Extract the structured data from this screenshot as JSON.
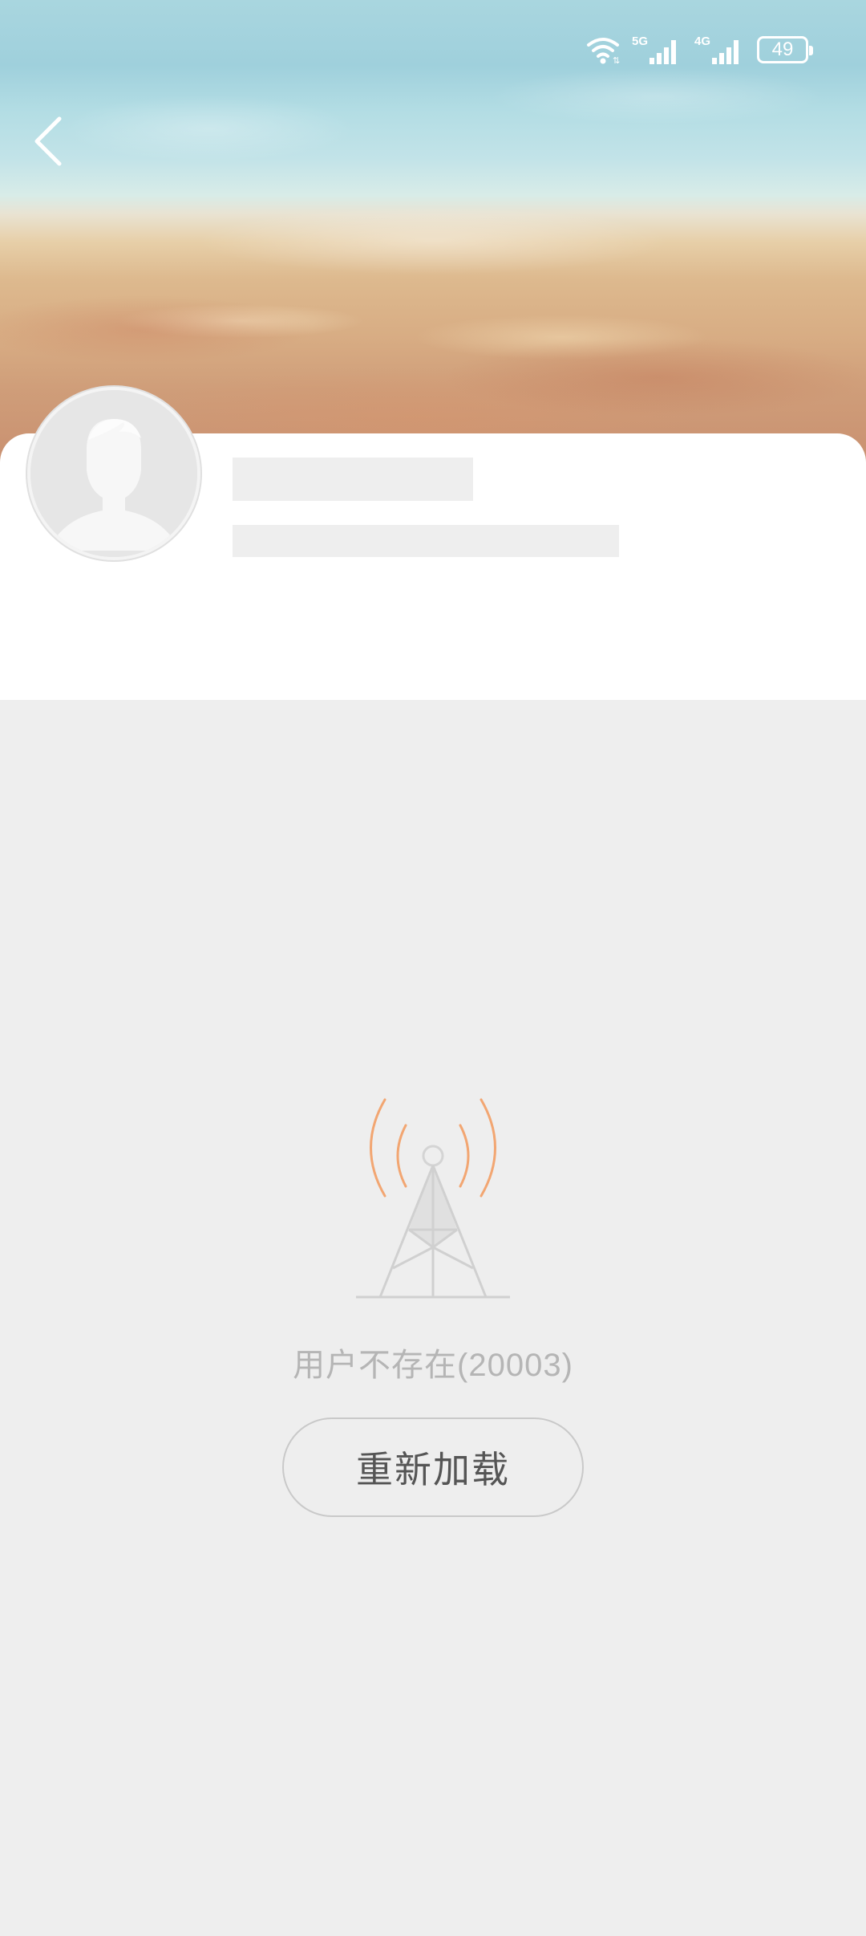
{
  "status_bar": {
    "network_5g": "5G",
    "network_4g": "4G",
    "battery_level": "49"
  },
  "header": {
    "back_icon": "chevron-left-icon"
  },
  "profile": {
    "avatar_icon": "default-user-avatar-icon",
    "name_loading": true,
    "subtitle_loading": true
  },
  "error_state": {
    "icon": "signal-tower-icon",
    "message": "用户不存在(20003)",
    "reload_label": "重新加载"
  },
  "colors": {
    "signal_waves": "#f2a672",
    "background": "#eeeeee",
    "card": "#ffffff"
  }
}
